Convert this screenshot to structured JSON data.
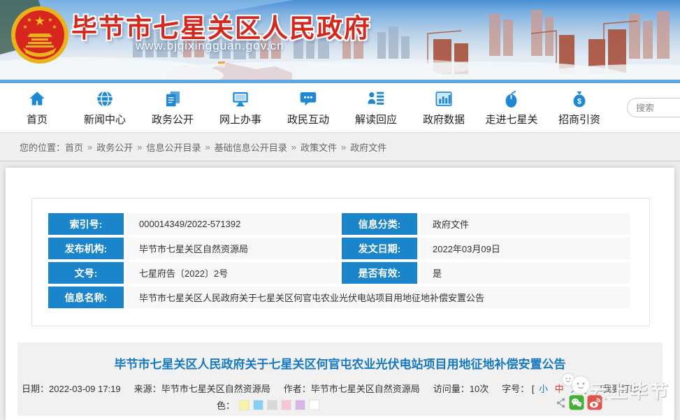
{
  "header": {
    "site_title": "毕节市七星关区人民政府",
    "site_url": "www.bjqixingguan.gov.cn"
  },
  "nav": {
    "items": [
      {
        "label": "首页"
      },
      {
        "label": "新闻中心"
      },
      {
        "label": "政务公开"
      },
      {
        "label": "网上办事"
      },
      {
        "label": "政民互动"
      },
      {
        "label": "解读回应"
      },
      {
        "label": "政府数据"
      },
      {
        "label": "走进七星关"
      },
      {
        "label": "招商引资"
      }
    ],
    "search_placeholder": "搜索"
  },
  "breadcrumb": {
    "prefix": "您的位置：",
    "separator": "»",
    "items": [
      "首页",
      "政务公开",
      "信息公开目录",
      "基础信息公开目录",
      "政策文件",
      "政府文件"
    ]
  },
  "info_table": {
    "rows": [
      {
        "l1": "索引号:",
        "v1": "000014349/2022-571392",
        "l2": "信息分类:",
        "v2": "政府文件"
      },
      {
        "l1": "发布机构:",
        "v1": "毕节市七星关区自然资源局",
        "l2": "发文日期:",
        "v2": "2022年03月09日"
      },
      {
        "l1": "文号:",
        "v1": "七星府告〔2022〕2号",
        "l2": "是否有效:",
        "v2": "是"
      }
    ],
    "full_row": {
      "label": "信息名称:",
      "value": "毕节市七星关区人民政府关于七星关区何官屯农业光伏电站项目用地征地补偿安置公告"
    }
  },
  "article": {
    "title": "毕节市七星关区人民政府关于七星关区何官屯农业光伏电站项目用地征地补偿安置公告",
    "meta": {
      "date_label": "日期：",
      "date_value": "2022-03-09 17:19",
      "source_label": "来源：",
      "source_value": "毕节市七星关区自然资源局",
      "author_label": "作者：",
      "author_value": "毕节市七星关区自然资源局",
      "visits_label": "访问量：",
      "visits_value": "10次",
      "fontsize_label": "字号：",
      "bracket_open": "[",
      "size_small": "小",
      "size_medium": "中",
      "size_large": "大",
      "bracket_close": "]",
      "print_label": "[我要打印]"
    },
    "color_label": "色：",
    "color_swatches": [
      "#f7f3a3",
      "#87cef0",
      "#d8d8d8",
      "#f6c6d2",
      "#d8b4e8",
      "#ffffff"
    ]
  },
  "watermark": {
    "text": "云上毕节"
  },
  "colors": {
    "accent_blue": "#1b85cb",
    "nav_icon_blue": "#1e88d2",
    "title_blue": "#1779c0",
    "header_red": "#d3281e"
  }
}
